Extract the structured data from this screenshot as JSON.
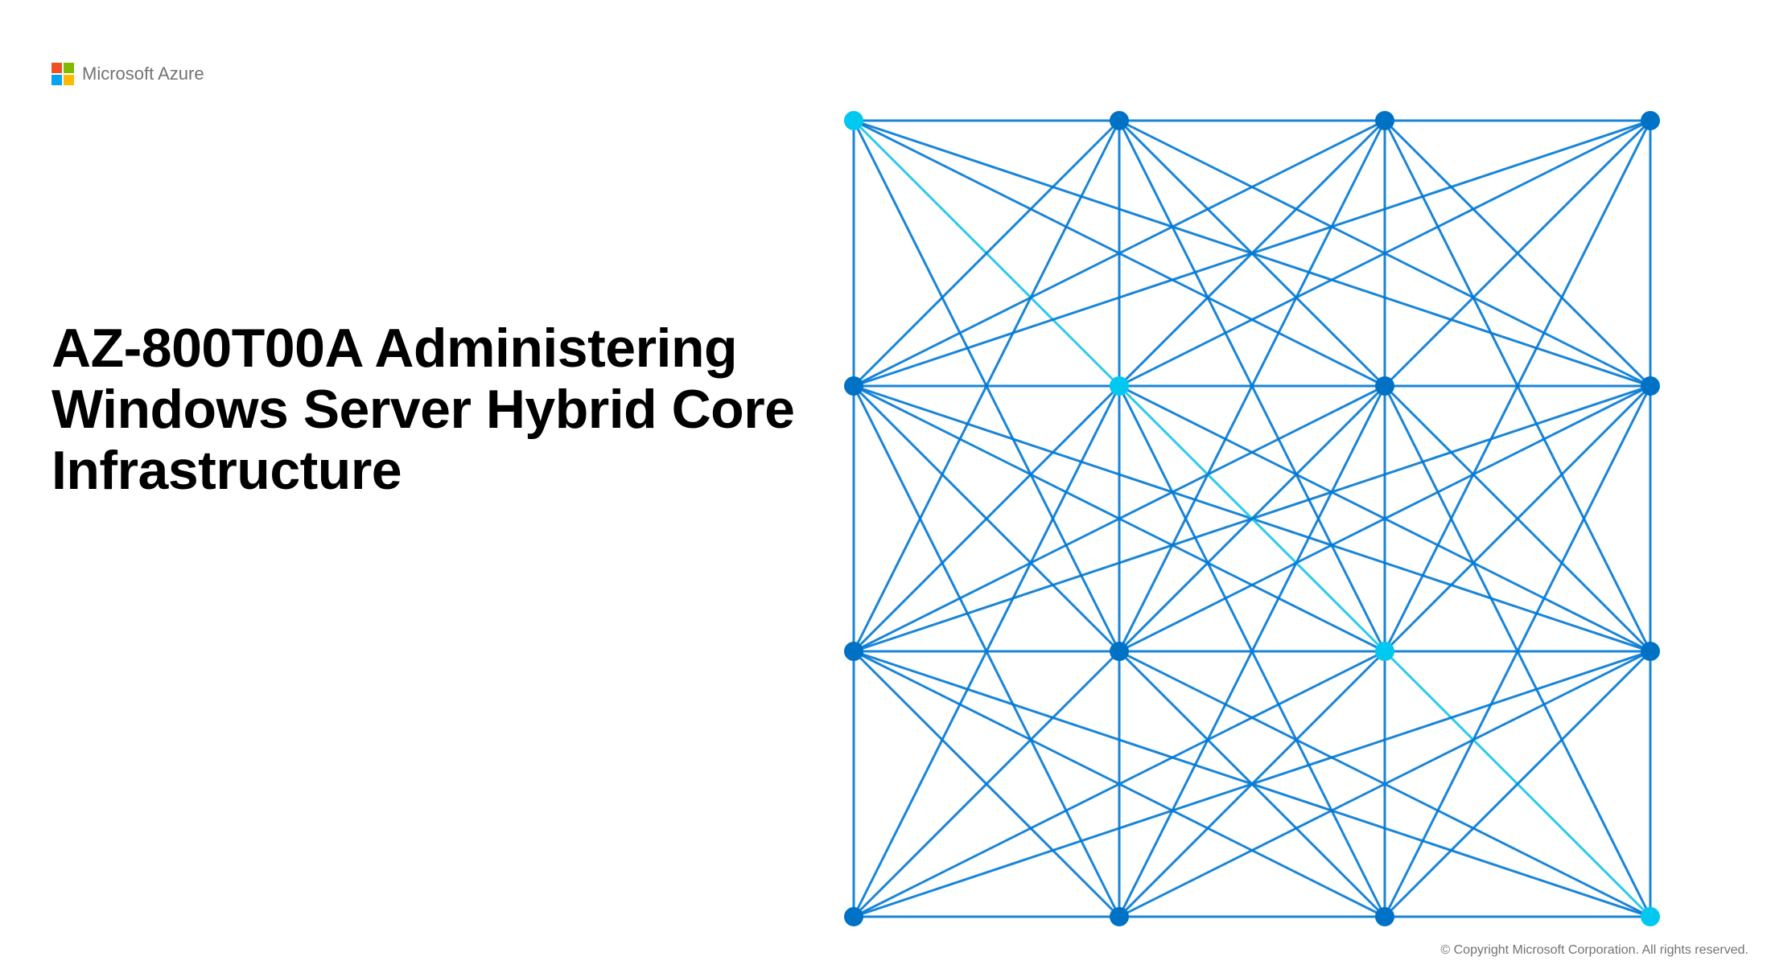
{
  "brand": {
    "name": "Microsoft Azure",
    "logo_colors": {
      "top_left": "#f25022",
      "top_right": "#7fba00",
      "bottom_left": "#00a4ef",
      "bottom_right": "#ffb900"
    }
  },
  "slide": {
    "title": "AZ-800T00A Administering Windows Server Hybrid Core Infrastructure"
  },
  "footer": {
    "copyright": "© Copyright Microsoft Corporation. All rights reserved."
  },
  "graphic": {
    "node_color_primary": "#0072C6",
    "node_color_accent": "#00C8F0",
    "line_color_primary": "#0078D4",
    "line_color_accent": "#20C8E8",
    "grid": {
      "rows": 4,
      "cols": 4
    },
    "accent_nodes": [
      [
        0,
        0
      ],
      [
        1,
        1
      ],
      [
        2,
        2
      ],
      [
        3,
        3
      ]
    ]
  }
}
